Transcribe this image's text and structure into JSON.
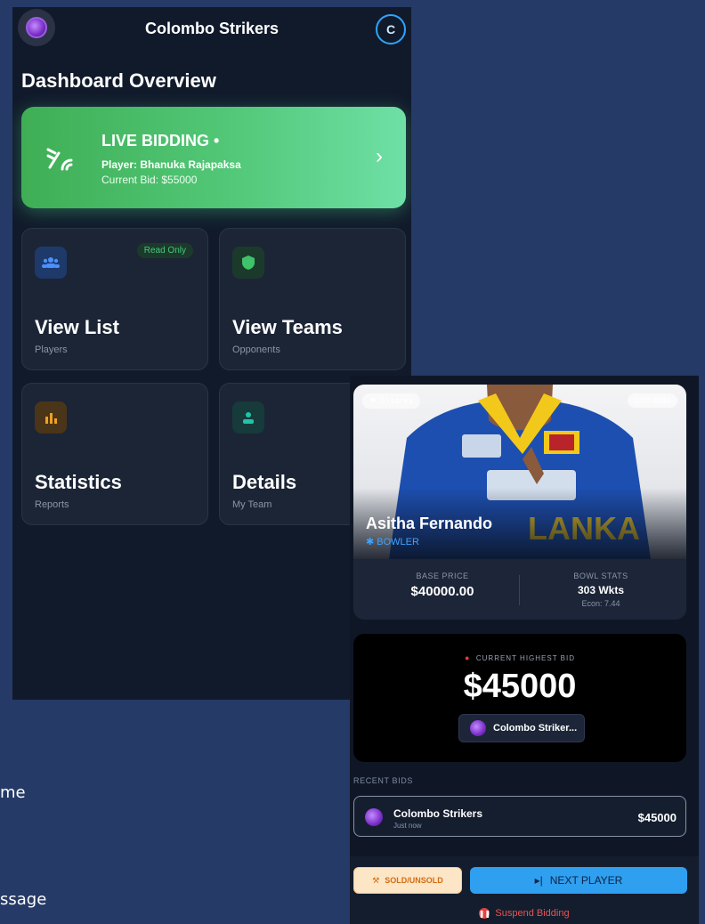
{
  "background_fragments": [
    "me",
    "ssage"
  ],
  "dashboard": {
    "team_name": "Colombo Strikers",
    "avatar_initial": "C",
    "heading": "Dashboard Overview",
    "live": {
      "title": "LIVE BIDDING •",
      "player": "Player: Bhanuka Rajapaksa",
      "current_bid": "Current Bid: $55000"
    },
    "tiles": [
      {
        "label": "View List",
        "sub": "Players",
        "badge": "Read Only",
        "icon": "users-icon",
        "color": "#2f7df0"
      },
      {
        "label": "View Teams",
        "sub": "Opponents",
        "icon": "shield-icon",
        "color": "#3ec26a"
      },
      {
        "label": "Statistics",
        "sub": "Reports",
        "icon": "bar-chart-icon",
        "color": "#f0a020"
      },
      {
        "label": "Details",
        "sub": "My Team",
        "icon": "person-icon",
        "color": "#22c3a8"
      }
    ]
  },
  "auction": {
    "country": "Sri Lanka",
    "lot": "LOT #084",
    "player_name": "Asitha Fernando",
    "role": "BOWLER",
    "base_price_label": "BASE PRICE",
    "base_price": "$40000.00",
    "stats_label": "BOWL STATS",
    "stats_value": "303 Wkts",
    "stats_sub": "Econ: 7.44",
    "bid_label": "CURRENT HIGHEST BID",
    "bid_amount": "$45000",
    "bid_team": "Colombo Striker...",
    "recent_label": "RECENT BIDS",
    "recent": {
      "team": "Colombo Strikers",
      "time": "Just now",
      "amount": "$45000"
    },
    "sold_label": "SOLD/UNSOLD",
    "next_label": "NEXT PLAYER",
    "suspend_label": "Suspend Bidding"
  }
}
